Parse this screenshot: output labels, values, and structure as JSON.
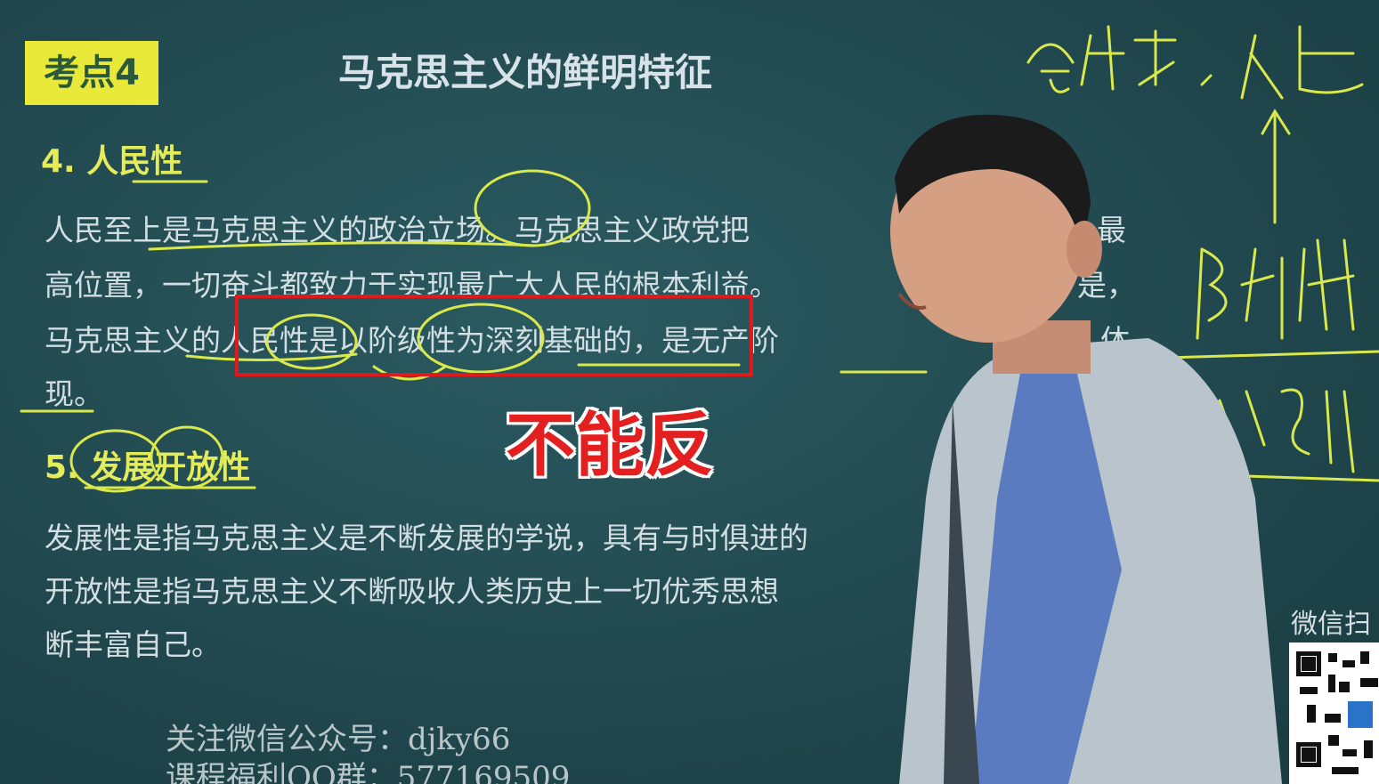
{
  "slide": {
    "badge": "考点4",
    "title": "马克思主义的鲜明特征",
    "section4_heading": "4. 人民性",
    "section4_lines": [
      "人民至上是马克思主义的政治立场。马克思主义政党把",
      "高位置，一切奋斗都致力于实现最广大人民的根本利益。",
      "马克思主义的人民性是以阶级性为深刻基础的，是无产阶",
      "现。"
    ],
    "section4_right_fragments": [
      "最",
      "是，",
      "体"
    ],
    "section5_heading": "5. 发展开放性",
    "section5_lines": [
      "发展性是指马克思主义是不断发展的学说，具有与时俱进的",
      "开放性是指马克思主义不断吸收人类历史上一切优秀思想",
      "断丰富自己。"
    ]
  },
  "overlay": {
    "caption": "不能反"
  },
  "footer": {
    "line1": "关注微信公众号：djky66",
    "line2": "课程福利QQ群：577169509"
  },
  "qr": {
    "label": "微信扫"
  },
  "colors": {
    "board": "#21494f",
    "badge": "#e9e93a",
    "highlight": "#d9e84a",
    "red_box": "#e01a1a",
    "caption": "#e41f1f"
  }
}
